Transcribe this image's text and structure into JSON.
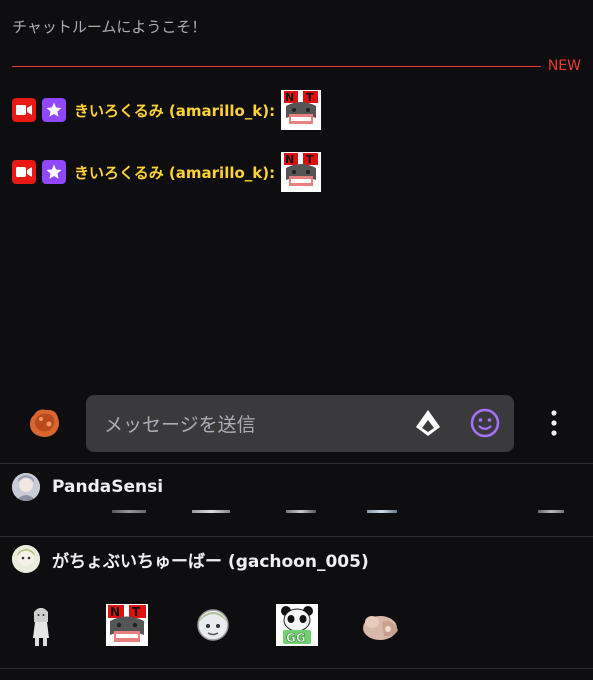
{
  "chat": {
    "welcome": "チャットルームにようこそ！",
    "new_label": "NEW",
    "messages": [
      {
        "username": "きいろくるみ (amarillo_k):",
        "badges": [
          "video-icon",
          "star-icon"
        ],
        "emote": "nt-emote"
      },
      {
        "username": "きいろくるみ (amarillo_k):",
        "badges": [
          "video-icon",
          "star-icon"
        ],
        "emote": "nt-emote"
      }
    ]
  },
  "input": {
    "placeholder": "メッセージを送信",
    "icons": [
      "channel-points-icon",
      "bits-icon",
      "emote-picker-icon",
      "more-options-icon"
    ]
  },
  "emote_sections": [
    {
      "name": "PandaSensi"
    },
    {
      "name": "がちょぶいちゅーばー (gachoon_005)",
      "emotes": [
        "figure-emote",
        "nt-emote",
        "face-emote",
        "panda-gg-emote",
        "hand-emote"
      ]
    }
  ],
  "colors": {
    "background": "#0e0e10",
    "username": "#ffd234",
    "new_divider": "#eb3a33",
    "input_bg": "#3a3a3d",
    "accent_purple": "#9147ff",
    "badge_red": "#e91916"
  }
}
